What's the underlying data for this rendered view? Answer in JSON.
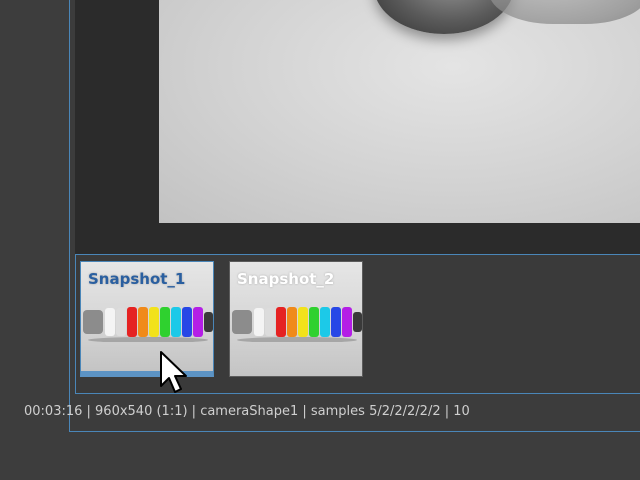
{
  "snapshots": [
    {
      "label": "Snapshot_1",
      "selected": true
    },
    {
      "label": "Snapshot_2",
      "selected": false
    }
  ],
  "status_bar": {
    "text": "00:03:16 | 960x540 (1:1) | cameraShape1   | samples 5/2/2/2/2/2 | 10"
  },
  "colors": {
    "accent": "#4a86b8",
    "selected_label": "#2a5fa0",
    "status_text": "#cfcfcf",
    "panel_bg": "#3c3c3c",
    "viewport_bg": "#2b2b2b"
  },
  "icons": {
    "cursor": "mouse-pointer-arrow"
  }
}
